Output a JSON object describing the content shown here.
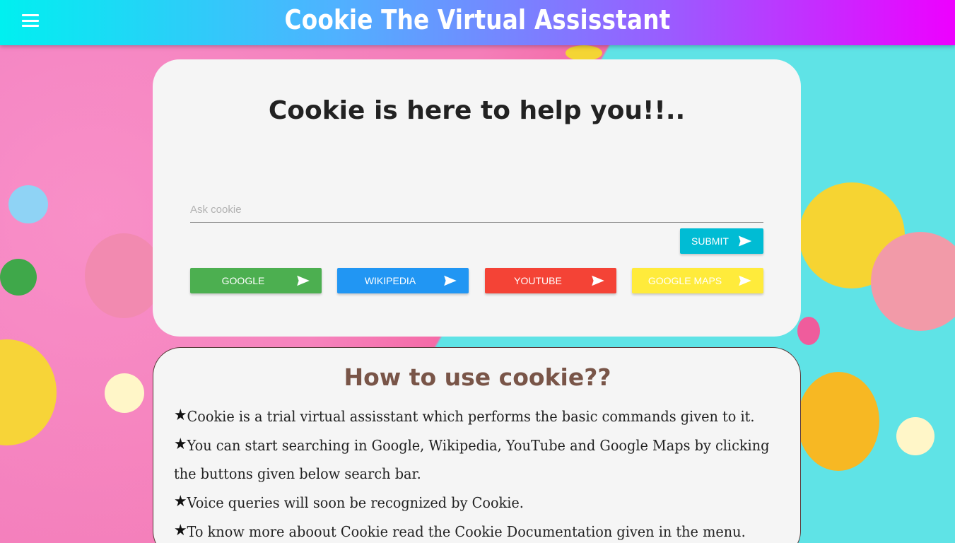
{
  "header": {
    "title": "Cookie The Virtual Assisstant"
  },
  "main": {
    "heading": "Cookie is here to help you!!..",
    "search": {
      "placeholder": "Ask cookie",
      "value": ""
    },
    "submit_label": "SUBMIT",
    "buttons": [
      {
        "label": "GOOGLE",
        "color": "#4caf50"
      },
      {
        "label": "WIKIPEDIA",
        "color": "#2196f3"
      },
      {
        "label": "YOUTUBE",
        "color": "#f44336"
      },
      {
        "label": "GOOGLE MAPS",
        "color": "#ffeb3b"
      }
    ],
    "submit_color": "#00bcd4"
  },
  "howto": {
    "title": "How to use cookie??",
    "bullet": "★",
    "items": [
      "Cookie is a trial virtual assisstant which performs the basic commands given to it.",
      "You can start searching in Google, Wikipedia, YouTube and Google Maps by clicking",
      "the buttons given below search bar.",
      "Voice queries will soon be recognized by Cookie.",
      "To know more aboout Cookie read the Cookie Documentation given in the menu."
    ]
  },
  "icons": {
    "menu": "menu-icon",
    "send": "send-icon"
  }
}
